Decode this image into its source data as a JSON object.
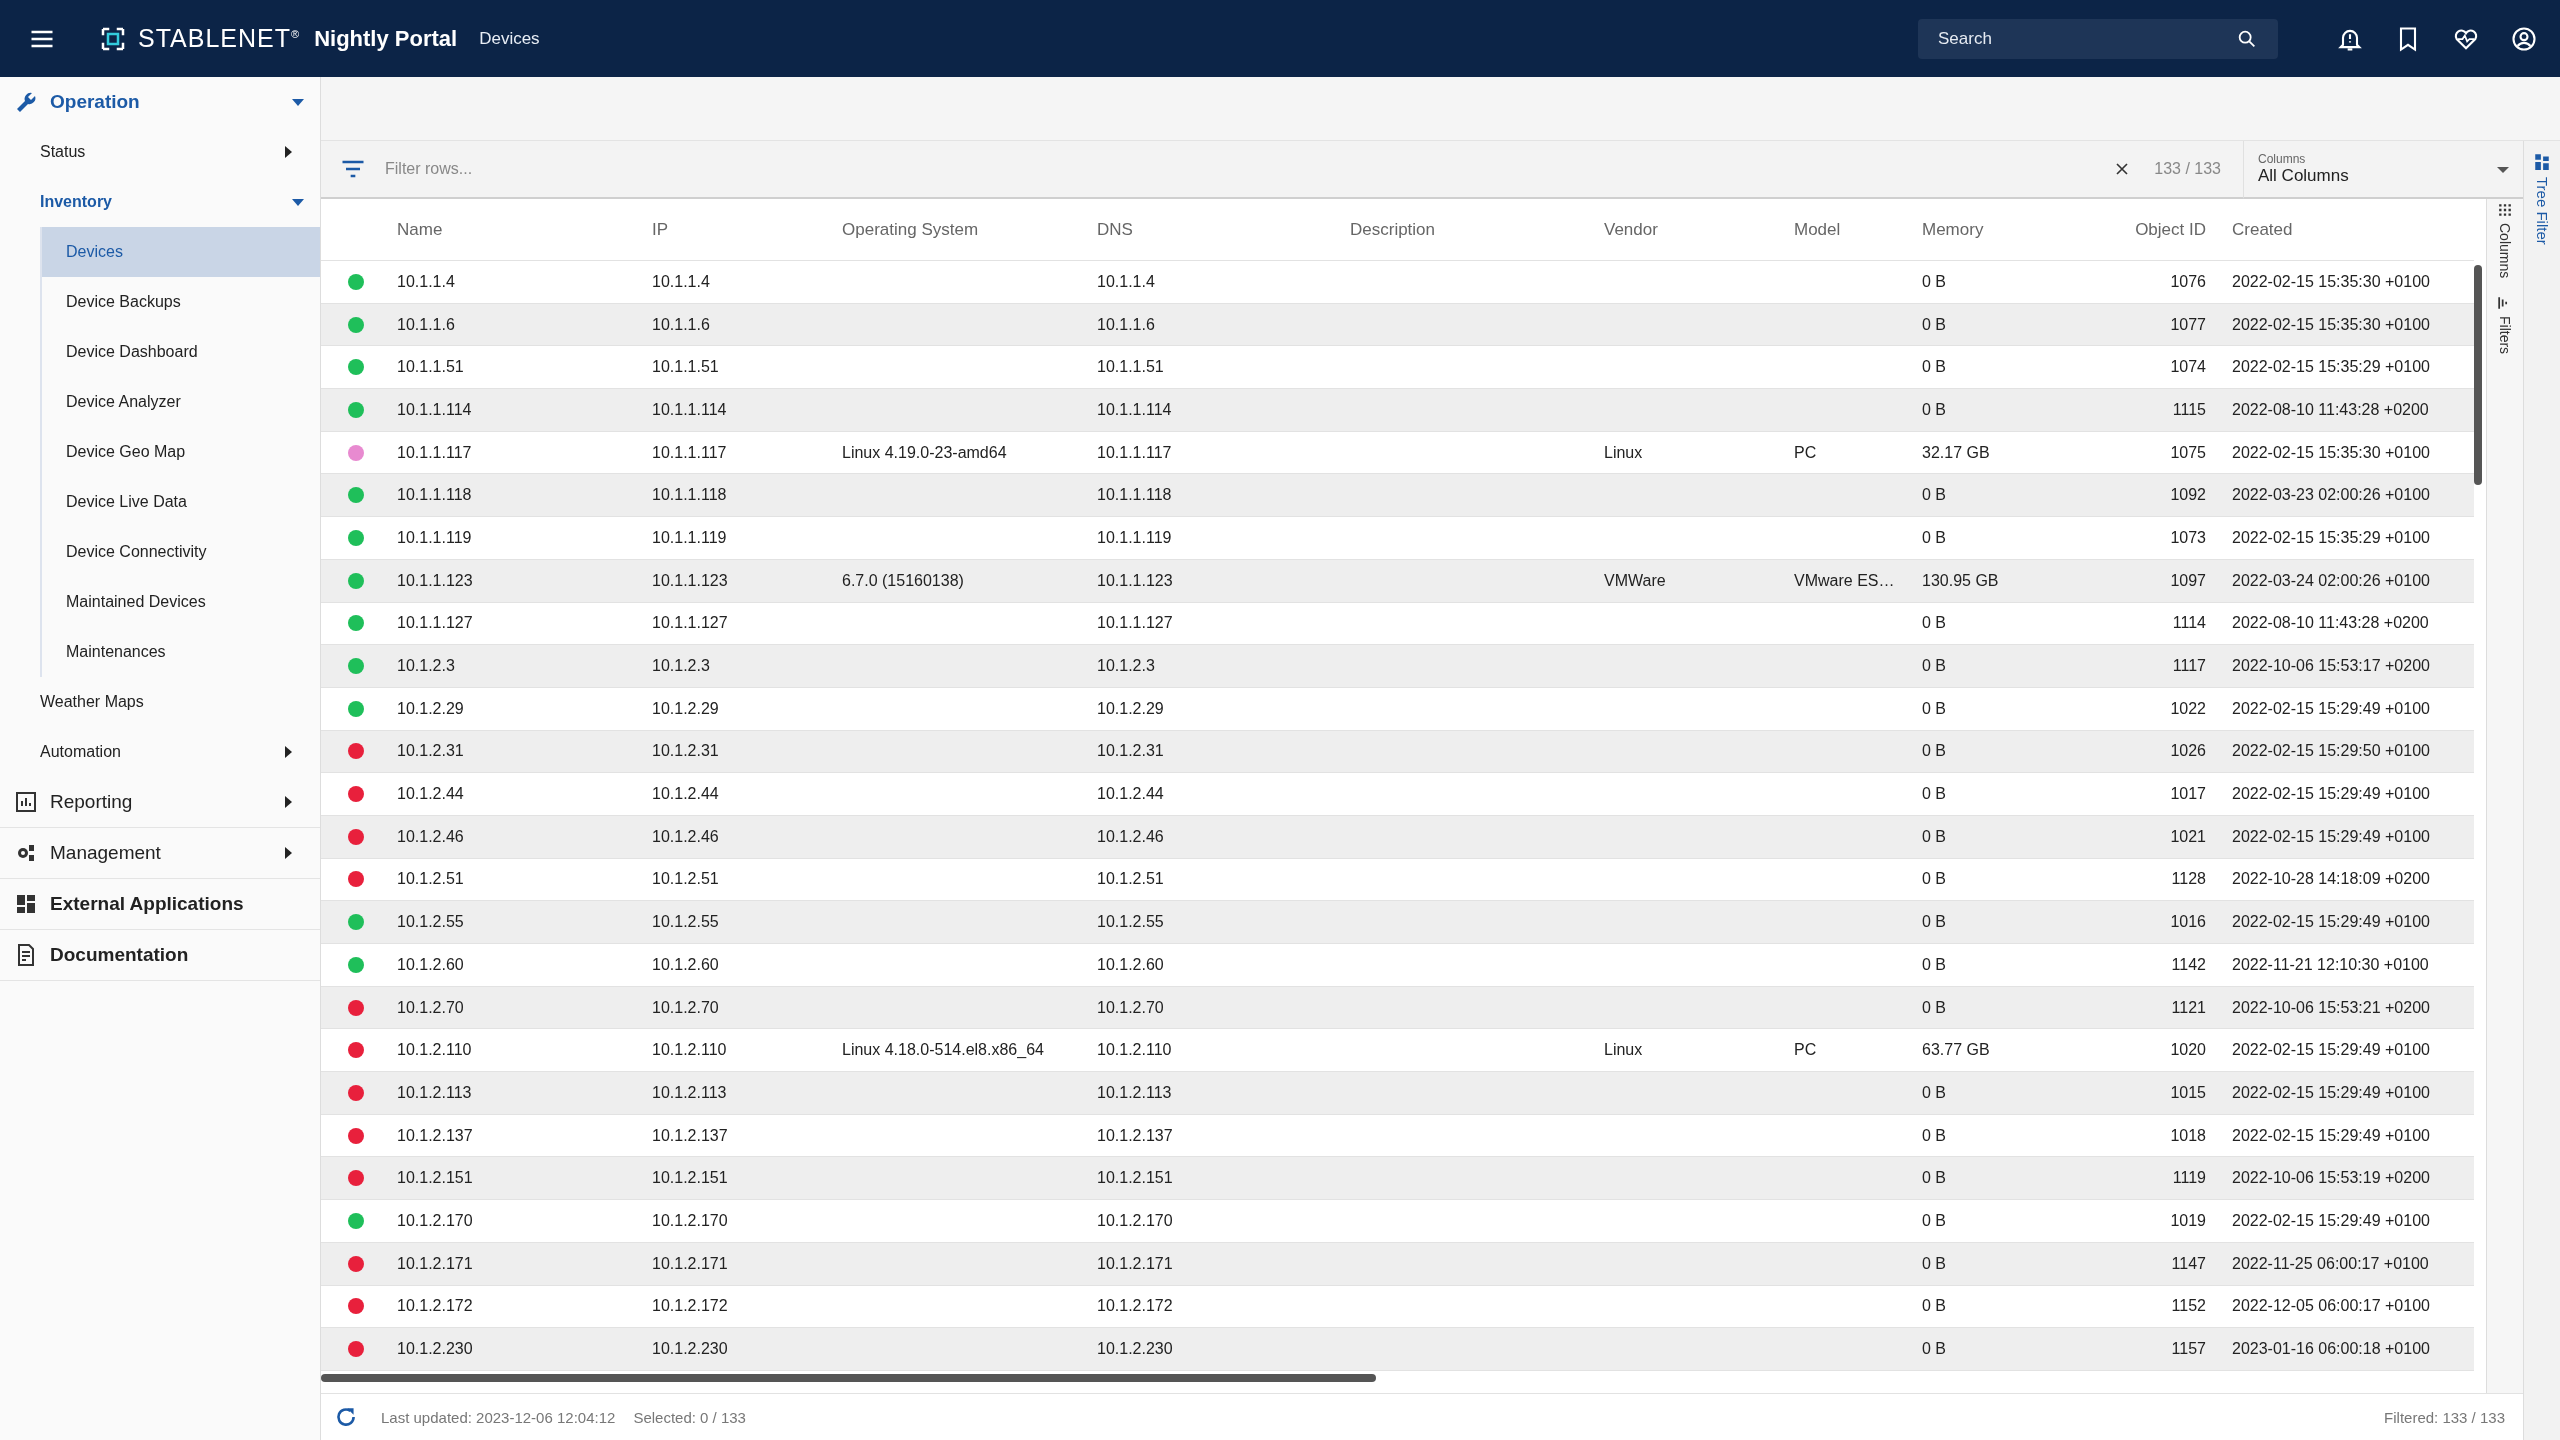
{
  "header": {
    "logo": "STABLENET$^{®}$",
    "app_name": "Nightly Portal",
    "breadcrumb": "Devices",
    "search": {
      "placeholder": "Search"
    }
  },
  "sidebar": {
    "sections": [
      {
        "label": "Operation",
        "expanded": true,
        "children": [
          {
            "label": "Status",
            "expanded": false
          },
          {
            "label": "Inventory",
            "expanded": true,
            "children": [
              {
                "label": "Devices",
                "selected": true
              },
              {
                "label": "Device Backups",
                "selected": false
              },
              {
                "label": "Device Dashboard",
                "selected": false
              },
              {
                "label": "Device Analyzer",
                "selected": false
              },
              {
                "label": "Device Geo Map",
                "selected": false
              },
              {
                "label": "Device Live Data",
                "selected": false
              },
              {
                "label": "Device Connectivity",
                "selected": false
              },
              {
                "label": "Maintained Devices",
                "selected": false
              },
              {
                "label": "Maintenances",
                "selected": false
              }
            ]
          },
          {
            "label": "Weather Maps"
          },
          {
            "label": "Automation",
            "expanded": false
          }
        ]
      },
      {
        "label": "Reporting",
        "expanded": false
      },
      {
        "label": "Management",
        "expanded": false
      },
      {
        "label": "External Applications"
      },
      {
        "label": "Documentation"
      }
    ]
  },
  "toolbar": {
    "filter": {
      "placeholder": "Filter rows..."
    },
    "count": "133 / 133",
    "columns_select": {
      "label": "Columns",
      "value": "All Columns"
    }
  },
  "table": {
    "columns": [
      "Name",
      "IP",
      "Operating System",
      "DNS",
      "Description",
      "Vendor",
      "Model",
      "Memory",
      "Object ID",
      "Created"
    ],
    "rows": [
      {
        "color": "#1fbf5a",
        "name": "10.1.1.4",
        "ip": "10.1.1.4",
        "dns": "10.1.1.4",
        "memory": "0 B",
        "object_id": "1076",
        "created": "2022-02-15 15:35:30 +0100"
      },
      {
        "color": "#1fbf5a",
        "name": "10.1.1.6",
        "ip": "10.1.1.6",
        "dns": "10.1.1.6",
        "memory": "0 B",
        "object_id": "1077",
        "created": "2022-02-15 15:35:30 +0100"
      },
      {
        "color": "#1fbf5a",
        "name": "10.1.1.51",
        "ip": "10.1.1.51",
        "dns": "10.1.1.51",
        "memory": "0 B",
        "object_id": "1074",
        "created": "2022-02-15 15:35:29 +0100"
      },
      {
        "color": "#1fbf5a",
        "name": "10.1.1.114",
        "ip": "10.1.1.114",
        "dns": "10.1.1.114",
        "memory": "0 B",
        "object_id": "1115",
        "created": "2022-08-10 11:43:28 +0200"
      },
      {
        "color": "#e88ad0",
        "name": "10.1.1.117",
        "ip": "10.1.1.117",
        "os": "Linux 4.19.0-23-amd64",
        "dns": "10.1.1.117",
        "vendor": "Linux",
        "model": "PC",
        "memory": "32.17 GB",
        "object_id": "1075",
        "created": "2022-02-15 15:35:30 +0100"
      },
      {
        "color": "#1fbf5a",
        "name": "10.1.1.118",
        "ip": "10.1.1.118",
        "dns": "10.1.1.118",
        "memory": "0 B",
        "object_id": "1092",
        "created": "2022-03-23 02:00:26 +0100"
      },
      {
        "color": "#1fbf5a",
        "name": "10.1.1.119",
        "ip": "10.1.1.119",
        "dns": "10.1.1.119",
        "memory": "0 B",
        "object_id": "1073",
        "created": "2022-02-15 15:35:29 +0100"
      },
      {
        "color": "#1fbf5a",
        "name": "10.1.1.123",
        "ip": "10.1.1.123",
        "os": "6.7.0 (15160138)",
        "dns": "10.1.1.123",
        "vendor": "VMWare",
        "model": "VMware ES…",
        "memory": "130.95 GB",
        "object_id": "1097",
        "created": "2022-03-24 02:00:26 +0100"
      },
      {
        "color": "#1fbf5a",
        "name": "10.1.1.127",
        "ip": "10.1.1.127",
        "dns": "10.1.1.127",
        "memory": "0 B",
        "object_id": "1114",
        "created": "2022-08-10 11:43:28 +0200"
      },
      {
        "color": "#1fbf5a",
        "name": "10.1.2.3",
        "ip": "10.1.2.3",
        "dns": "10.1.2.3",
        "memory": "0 B",
        "object_id": "1117",
        "created": "2022-10-06 15:53:17 +0200"
      },
      {
        "color": "#1fbf5a",
        "name": "10.1.2.29",
        "ip": "10.1.2.29",
        "dns": "10.1.2.29",
        "memory": "0 B",
        "object_id": "1022",
        "created": "2022-02-15 15:29:49 +0100"
      },
      {
        "color": "#e8203c",
        "name": "10.1.2.31",
        "ip": "10.1.2.31",
        "dns": "10.1.2.31",
        "memory": "0 B",
        "object_id": "1026",
        "created": "2022-02-15 15:29:50 +0100"
      },
      {
        "color": "#e8203c",
        "name": "10.1.2.44",
        "ip": "10.1.2.44",
        "dns": "10.1.2.44",
        "memory": "0 B",
        "object_id": "1017",
        "created": "2022-02-15 15:29:49 +0100"
      },
      {
        "color": "#e8203c",
        "name": "10.1.2.46",
        "ip": "10.1.2.46",
        "dns": "10.1.2.46",
        "memory": "0 B",
        "object_id": "1021",
        "created": "2022-02-15 15:29:49 +0100"
      },
      {
        "color": "#e8203c",
        "name": "10.1.2.51",
        "ip": "10.1.2.51",
        "dns": "10.1.2.51",
        "memory": "0 B",
        "object_id": "1128",
        "created": "2022-10-28 14:18:09 +0200"
      },
      {
        "color": "#1fbf5a",
        "name": "10.1.2.55",
        "ip": "10.1.2.55",
        "dns": "10.1.2.55",
        "memory": "0 B",
        "object_id": "1016",
        "created": "2022-02-15 15:29:49 +0100"
      },
      {
        "color": "#1fbf5a",
        "name": "10.1.2.60",
        "ip": "10.1.2.60",
        "dns": "10.1.2.60",
        "memory": "0 B",
        "object_id": "1142",
        "created": "2022-11-21 12:10:30 +0100"
      },
      {
        "color": "#e8203c",
        "name": "10.1.2.70",
        "ip": "10.1.2.70",
        "dns": "10.1.2.70",
        "memory": "0 B",
        "object_id": "1121",
        "created": "2022-10-06 15:53:21 +0200"
      },
      {
        "color": "#e8203c",
        "name": "10.1.2.110",
        "ip": "10.1.2.110",
        "os": "Linux 4.18.0-514.el8.x86_64",
        "dns": "10.1.2.110",
        "vendor": "Linux",
        "model": "PC",
        "memory": "63.77 GB",
        "object_id": "1020",
        "created": "2022-02-15 15:29:49 +0100"
      },
      {
        "color": "#e8203c",
        "name": "10.1.2.113",
        "ip": "10.1.2.113",
        "dns": "10.1.2.113",
        "memory": "0 B",
        "object_id": "1015",
        "created": "2022-02-15 15:29:49 +0100"
      },
      {
        "color": "#e8203c",
        "name": "10.1.2.137",
        "ip": "10.1.2.137",
        "dns": "10.1.2.137",
        "memory": "0 B",
        "object_id": "1018",
        "created": "2022-02-15 15:29:49 +0100"
      },
      {
        "color": "#e8203c",
        "name": "10.1.2.151",
        "ip": "10.1.2.151",
        "dns": "10.1.2.151",
        "memory": "0 B",
        "object_id": "1119",
        "created": "2022-10-06 15:53:19 +0200"
      },
      {
        "color": "#1fbf5a",
        "name": "10.1.2.170",
        "ip": "10.1.2.170",
        "dns": "10.1.2.170",
        "memory": "0 B",
        "object_id": "1019",
        "created": "2022-02-15 15:29:49 +0100"
      },
      {
        "color": "#e8203c",
        "name": "10.1.2.171",
        "ip": "10.1.2.171",
        "dns": "10.1.2.171",
        "memory": "0 B",
        "object_id": "1147",
        "created": "2022-11-25 06:00:17 +0100"
      },
      {
        "color": "#e8203c",
        "name": "10.1.2.172",
        "ip": "10.1.2.172",
        "dns": "10.1.2.172",
        "memory": "0 B",
        "object_id": "1152",
        "created": "2022-12-05 06:00:17 +0100"
      },
      {
        "color": "#e8203c",
        "name": "10.1.2.230",
        "ip": "10.1.2.230",
        "dns": "10.1.2.230",
        "memory": "0 B",
        "object_id": "1157",
        "created": "2023-01-16 06:00:18 +0100"
      }
    ]
  },
  "side_tabs": [
    "Columns",
    "Filters"
  ],
  "tree_filter_tab": "Tree Filter",
  "status_bar": {
    "last_updated": "Last updated: 2023-12-06 12:04:12",
    "selected": "Selected: 0 / 133",
    "filtered": "Filtered: 133 / 133"
  }
}
